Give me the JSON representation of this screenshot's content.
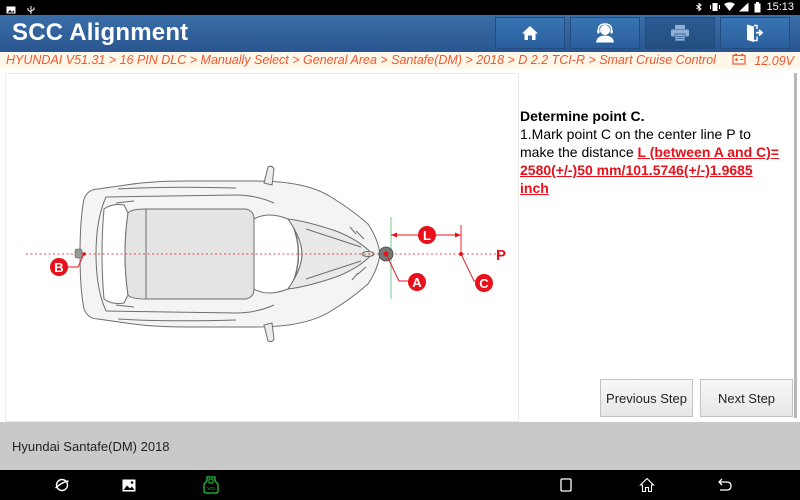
{
  "status_bar": {
    "left_icons": [
      "image-notification-icon",
      "usb-icon"
    ],
    "right_icons": [
      "bluetooth-icon",
      "vibrate-icon",
      "wifi-icon",
      "signal-icon",
      "battery-icon"
    ],
    "time": "15:13"
  },
  "header": {
    "title": "SCC Alignment",
    "buttons": [
      {
        "name": "home",
        "icon": "home-icon"
      },
      {
        "name": "support",
        "icon": "headset-user-icon"
      },
      {
        "name": "print",
        "icon": "printer-icon"
      },
      {
        "name": "exit",
        "icon": "exit-door-icon"
      }
    ]
  },
  "breadcrumb": {
    "path": "HYUNDAI V51.31 > 16 PIN DLC > Manually Select > General Area > Santafe(DM) > 2018 > D 2.2 TCI-R > Smart Cruise Control",
    "battery_icon": "car-battery-icon",
    "voltage": "12.09V"
  },
  "diagram": {
    "labels": {
      "a": "A",
      "b": "B",
      "c": "C",
      "l": "L",
      "p": "P"
    },
    "colors": {
      "marker": "#e8101b",
      "centerline": "#e8101b",
      "guide": "#8fd8a8"
    }
  },
  "instructions": {
    "title": "Determine point C.",
    "body_prefix": "1.Mark point C on the center line P to make the distance ",
    "highlight": "L (between A and C)= 2580(+/-)50 mm/101.5746(+/-)1.9685 inch"
  },
  "buttons": {
    "previous": "Previous Step",
    "next": "Next Step"
  },
  "footer": {
    "vehicle": "Hyundai Santafe(DM) 2018"
  },
  "nav_bar": {
    "left_icons": [
      "browser-icon",
      "gallery-icon",
      "vci-icon"
    ],
    "right_icons": [
      "recent-apps-icon",
      "home-icon",
      "back-icon"
    ],
    "vci_color": "#22c43a"
  }
}
